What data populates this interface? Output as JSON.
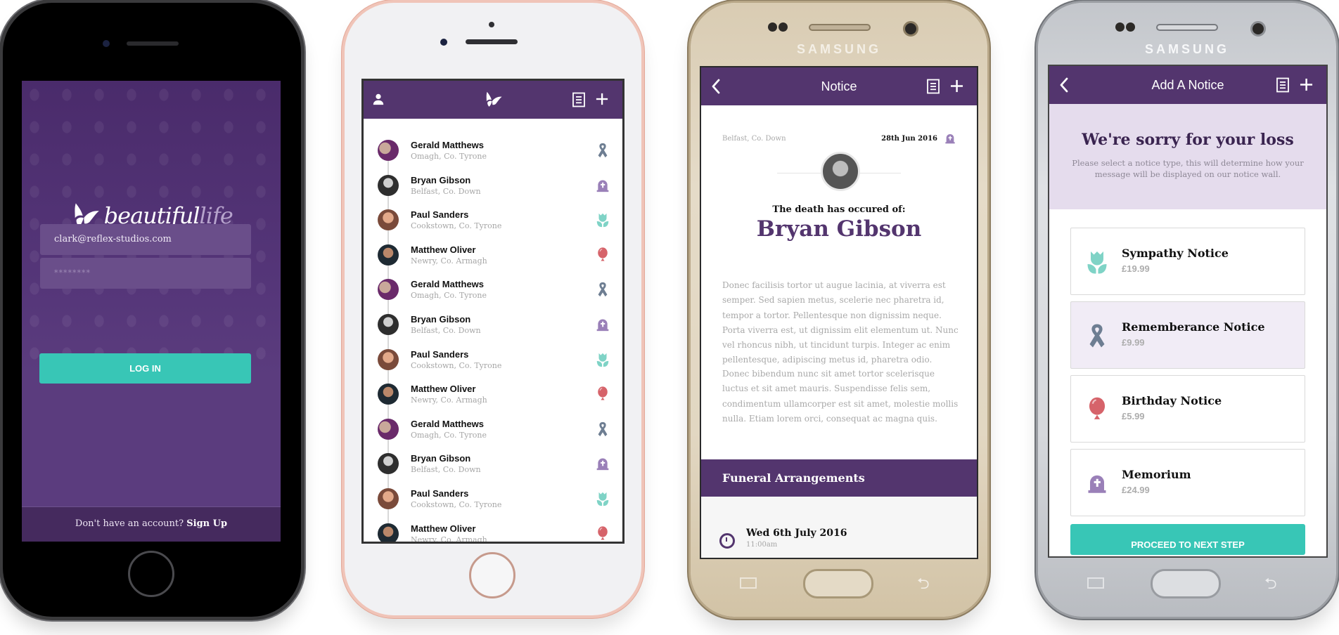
{
  "colors": {
    "brand_purple": "#53356e",
    "login_purple": "#5b3c7e",
    "accent_teal": "#38c6b6",
    "ribbon_gray": "#6e7e92",
    "tombstone_lilac": "#9a80b8",
    "tulip_mint": "#7fd3c6",
    "balloon_coral": "#d6636a"
  },
  "login": {
    "logo_word1": "beautiful",
    "logo_word2": "life",
    "email_value": "clark@reflex-studios.com",
    "password_value": "********",
    "login_label": "LOG IN",
    "signup_prompt": "Don't have an account?",
    "signup_link": "Sign Up"
  },
  "wall": {
    "header_icons": [
      "user-icon",
      "butterfly-logo-icon",
      "notice-list-icon",
      "plus-icon"
    ],
    "entries": [
      {
        "name": "Gerald Matthews",
        "location": "Omagh, Co. Tyrone",
        "type": "ribbon-icon"
      },
      {
        "name": "Bryan Gibson",
        "location": "Belfast, Co. Down",
        "type": "tombstone-icon"
      },
      {
        "name": "Paul Sanders",
        "location": "Cookstown, Co. Tyrone",
        "type": "tulip-icon"
      },
      {
        "name": "Matthew Oliver",
        "location": "Newry, Co. Armagh",
        "type": "balloon-icon"
      },
      {
        "name": "Gerald Matthews",
        "location": "Omagh, Co. Tyrone",
        "type": "ribbon-icon"
      },
      {
        "name": "Bryan Gibson",
        "location": "Belfast, Co. Down",
        "type": "tombstone-icon"
      },
      {
        "name": "Paul Sanders",
        "location": "Cookstown, Co. Tyrone",
        "type": "tulip-icon"
      },
      {
        "name": "Matthew Oliver",
        "location": "Newry, Co. Armagh",
        "type": "balloon-icon"
      },
      {
        "name": "Gerald Matthews",
        "location": "Omagh, Co. Tyrone",
        "type": "ribbon-icon"
      },
      {
        "name": "Bryan Gibson",
        "location": "Belfast, Co. Down",
        "type": "tombstone-icon"
      },
      {
        "name": "Paul Sanders",
        "location": "Cookstown, Co. Tyrone",
        "type": "tulip-icon"
      },
      {
        "name": "Matthew Oliver",
        "location": "Newry, Co. Armagh",
        "type": "balloon-icon"
      }
    ]
  },
  "notice": {
    "device_brand": "SAMSUNG",
    "title": "Notice",
    "location": "Belfast, Co. Down",
    "date": "28th Jun 2016",
    "death_label": "The death has occured of:",
    "deceased_name": "Bryan Gibson",
    "paragraph1": "Donec facilisis tortor ut augue lacinia, at viverra est semper. Sed sapien metus, scelerie nec pharetra id, tempor a tortor. Pellentesque non dignissim neque. Porta viverra est, ut dignissim elit elementum ut. Nunc vel rhoncus nibh, ut tincidunt turpis. Integer ac enim pellentesque, adipiscing metus id, pharetra odio.",
    "paragraph2": "Donec bibendum nunc sit amet tortor scelerisque luctus et sit amet mauris. Suspendisse felis sem, condimentum ullamcorper est sit amet, molestie mollis nulla. Etiam lorem orci, consequat ac magna quis.",
    "arrangements_heading": "Funeral Arrangements",
    "arrangement_date": "Wed 6th July 2016",
    "arrangement_time": "11:00am"
  },
  "add_notice": {
    "device_brand": "SAMSUNG",
    "title": "Add A Notice",
    "heading": "We're  sorry for your loss",
    "subtext": "Please select a notice type, this will determine how your message will be displayed on our notice wall.",
    "options": [
      {
        "title": "Sympathy Notice",
        "price": "£19.99",
        "icon": "tulip-icon",
        "selected": false
      },
      {
        "title": "Rememberance Notice",
        "price": "£9.99",
        "icon": "ribbon-icon",
        "selected": true
      },
      {
        "title": "Birthday Notice",
        "price": "£5.99",
        "icon": "balloon-icon",
        "selected": false
      },
      {
        "title": "Memorium",
        "price": "£24.99",
        "icon": "tombstone-icon",
        "selected": false
      }
    ],
    "proceed_label": "PROCEED TO NEXT STEP"
  }
}
